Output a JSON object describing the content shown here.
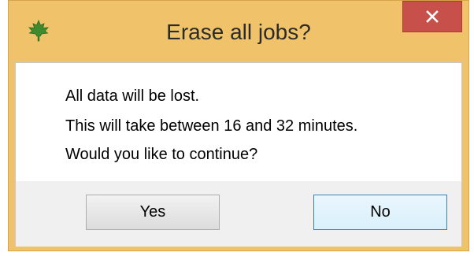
{
  "dialog": {
    "title": "Erase all jobs?",
    "close_glyph": "✕",
    "app_icon": "maple-leaf-icon",
    "messages": [
      "All data will be lost.",
      "This will take between 16 and 32 minutes.",
      "Would you like to continue?"
    ],
    "buttons": {
      "yes": "Yes",
      "no": "No"
    }
  },
  "colors": {
    "titlebar": "#f0c36a",
    "close_button": "#c7514a",
    "icon": "#3f8a2c",
    "default_button_border": "#3c7fb1"
  }
}
